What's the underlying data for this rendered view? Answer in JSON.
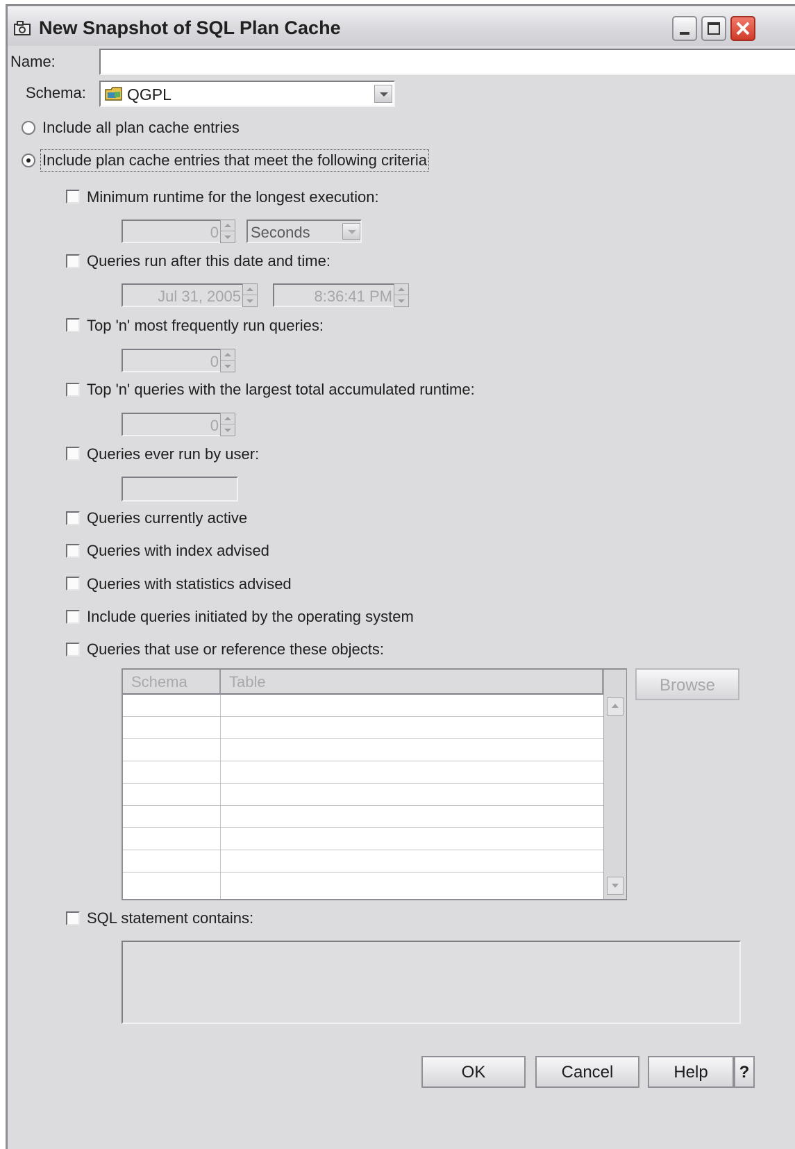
{
  "window": {
    "title": "New Snapshot of SQL Plan Cache"
  },
  "name": {
    "label": "Name:",
    "value": ""
  },
  "schema": {
    "label": "Schema:",
    "value": "QGPL"
  },
  "scope": {
    "all_label": "Include all plan cache entries",
    "criteria_label": "Include plan cache entries that meet the following criteria",
    "selected": "criteria"
  },
  "criteria": {
    "min_runtime": {
      "label": "Minimum runtime for the longest execution:",
      "value": "0",
      "unit": "Seconds"
    },
    "after_date": {
      "label": "Queries run after this date and time:",
      "date": "Jul 31, 2005",
      "time": "8:36:41 PM"
    },
    "top_frequent": {
      "label": "Top 'n' most frequently run queries:",
      "value": "0"
    },
    "top_runtime": {
      "label": "Top 'n' queries with the largest total accumulated runtime:",
      "value": "0"
    },
    "by_user": {
      "label": "Queries ever run by user:",
      "value": ""
    },
    "currently_active": {
      "label": "Queries currently active"
    },
    "index_advised": {
      "label": "Queries with index advised"
    },
    "stats_advised": {
      "label": "Queries with statistics advised"
    },
    "os_initiated": {
      "label": "Include queries initiated by the operating system"
    },
    "objects": {
      "label": "Queries that use or reference these objects:",
      "columns": [
        "Schema",
        "Table"
      ],
      "rows": [
        "",
        "",
        "",
        "",
        "",
        "",
        "",
        "",
        ""
      ],
      "browse_label": "Browse"
    },
    "sql_contains": {
      "label": "SQL statement contains:",
      "value": ""
    }
  },
  "buttons": {
    "ok": "OK",
    "cancel": "Cancel",
    "help": "Help",
    "whats_this": "?"
  },
  "icons": [
    "snapshot-icon",
    "folder-icon",
    "minimize-icon",
    "maximize-icon",
    "close-icon"
  ]
}
